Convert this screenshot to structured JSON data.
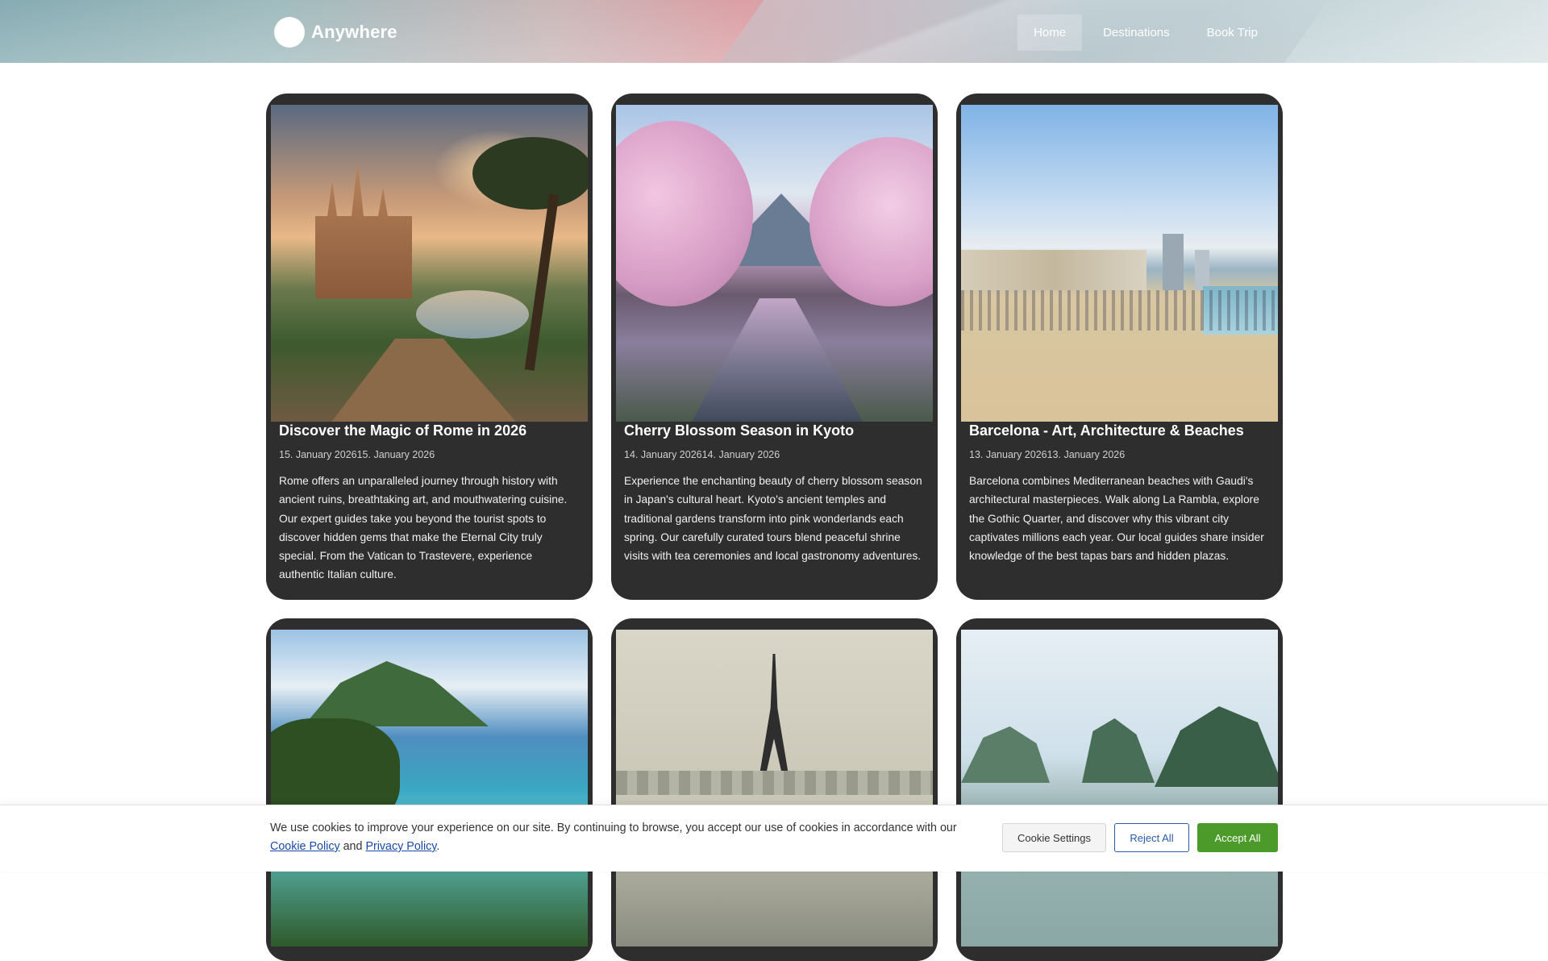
{
  "header": {
    "logo_text": "Anywhere",
    "nav": [
      {
        "label": "Home",
        "active": true
      },
      {
        "label": "Destinations",
        "active": false
      },
      {
        "label": "Book Trip",
        "active": false
      }
    ]
  },
  "cards": [
    {
      "title": "Discover the Magic of Rome in 2026",
      "date": "15. January 202615. January 2026",
      "text": "Rome offers an unparalleled journey through history with ancient ruins, breathtaking art, and mouthwatering cuisine. Our expert guides take you beyond the tourist spots to discover hidden gems that make the Eternal City truly special. From the Vatican to Trastevere, experience authentic Italian culture."
    },
    {
      "title": "Cherry Blossom Season in Kyoto",
      "date": "14. January 202614. January 2026",
      "text": "Experience the enchanting beauty of cherry blossom season in Japan's cultural heart. Kyoto's ancient temples and traditional gardens transform into pink wonderlands each spring. Our carefully curated tours blend peaceful shrine visits with tea ceremonies and local gastronomy adventures."
    },
    {
      "title": "Barcelona - Art, Architecture & Beaches",
      "date": "13. January 202613. January 2026",
      "text": "Barcelona combines Mediterranean beaches with Gaudi's architectural masterpieces. Walk along La Rambla, explore the Gothic Quarter, and discover why this vibrant city captivates millions each year. Our local guides share insider knowledge of the best tapas bars and hidden plazas."
    }
  ],
  "cookie": {
    "text_before": "We use cookies to improve your experience on our site. By continuing to browse, you accept our use of cookies in accordance with our ",
    "cookie_policy_link": "Cookie Policy",
    "and": " and ",
    "privacy_policy_link": "Privacy Policy",
    "text_after": ".",
    "settings_label": "Cookie Settings",
    "reject_label": "Reject All",
    "accept_label": "Accept All"
  },
  "colors": {
    "card_bg": "#2e2e2e",
    "accept_green": "#4c9a2a",
    "reject_blue": "#2a5aa8",
    "link_blue": "#1a4aa8"
  }
}
